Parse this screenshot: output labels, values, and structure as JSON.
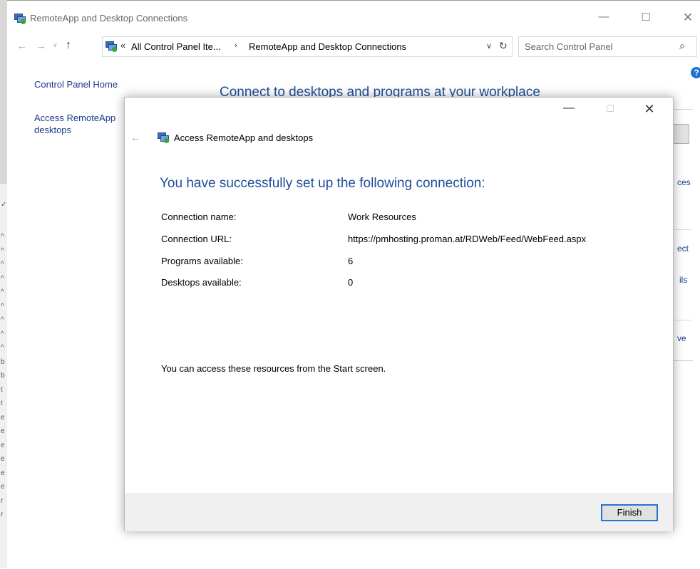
{
  "background": {
    "left_edge_marks": [
      "^",
      "^",
      "^",
      "^",
      "^",
      "^",
      "^",
      "^",
      "^",
      "b",
      "b",
      "t",
      "t",
      "e",
      "e",
      "e",
      "e",
      "e",
      "e",
      "r",
      "r"
    ]
  },
  "window": {
    "title": "RemoteApp and Desktop Connections",
    "controls": {
      "minimize": "—",
      "maximize": "☐",
      "close": "✕"
    }
  },
  "navigation": {
    "back": "←",
    "forward": "→",
    "recent": "∨",
    "up": "↑",
    "address": {
      "separator": "«",
      "crumbs": [
        "All Control Panel Ite...",
        "RemoteApp and Desktop Connections"
      ],
      "crumb_separator": "›",
      "dropdown": "∨",
      "refresh": "↻"
    },
    "search": {
      "placeholder": "Search Control Panel",
      "icon": "search-icon"
    }
  },
  "sidebar": {
    "links": [
      "Control Panel Home",
      "Access RemoteApp and desktops"
    ],
    "access_line1": "Access RemoteApp",
    "access_line2": "desktops"
  },
  "main": {
    "heading": "Connect to desktops and programs at your workplace",
    "help_icon": "?",
    "right_fragments": [
      "ces",
      "ect",
      "ils",
      "ve"
    ]
  },
  "wizard": {
    "title": "Access RemoteApp and desktops",
    "controls": {
      "minimize": "—",
      "maximize": "☐",
      "close": "✕",
      "back": "←"
    },
    "heading": "You have successfully set up the following connection:",
    "details": [
      {
        "label": "Connection name:",
        "value": "Work Resources"
      },
      {
        "label": "Connection URL:",
        "value": "https://pmhosting.proman.at/RDWeb/Feed/WebFeed.aspx"
      },
      {
        "label": "Programs available:",
        "value": "6"
      },
      {
        "label": "Desktops available:",
        "value": "0"
      }
    ],
    "note": "You can access these resources from the Start screen.",
    "finish_label": "Finish"
  },
  "colors": {
    "heading_blue": "#1e4d9b",
    "link_blue": "#1a3c8a",
    "focus_border": "#2a73d2",
    "footer_bg": "#f0f0f0"
  }
}
